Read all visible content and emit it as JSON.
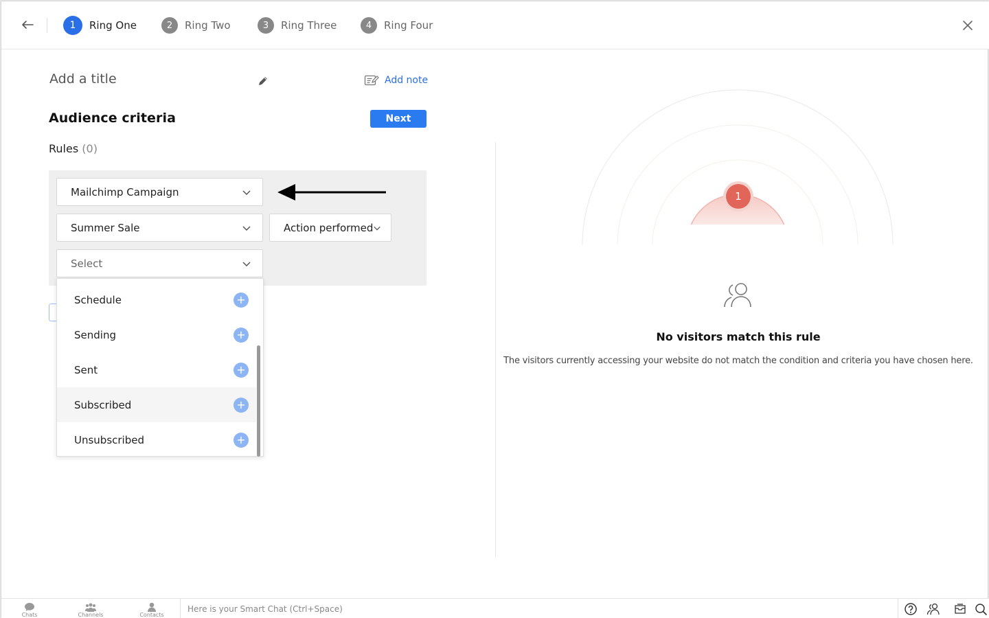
{
  "header": {
    "steps": [
      {
        "num": "1",
        "label": "Ring One"
      },
      {
        "num": "2",
        "label": "Ring Two"
      },
      {
        "num": "3",
        "label": "Ring Three"
      },
      {
        "num": "4",
        "label": "Ring Four"
      }
    ]
  },
  "editor": {
    "title_placeholder": "Add a title",
    "add_note": "Add note",
    "section_title": "Audience criteria",
    "next_label": "Next",
    "rules_label": "Rules",
    "rules_count": "(0)"
  },
  "rule": {
    "source": "Mailchimp Campaign",
    "campaign": "Summer Sale",
    "action": "Action performed",
    "event_placeholder": "Select"
  },
  "dropdown": {
    "options": [
      "Schedule",
      "Sending",
      "Sent",
      "Subscribed",
      "Unsubscribed"
    ],
    "hovered": "Subscribed"
  },
  "preview": {
    "ring_badge": "1",
    "empty_title": "No visitors match this rule",
    "empty_desc": "The visitors currently accessing your website do not match the condition and criteria you have chosen here."
  },
  "bottom_bar": {
    "nav": [
      "Chats",
      "Channels",
      "Contacts"
    ],
    "smart_chat_placeholder": "Here is your Smart Chat (Ctrl+Space)"
  },
  "colors": {
    "primary": "#2a6fe8",
    "ring_badge": "#e2655a",
    "plus": "#8db4f3"
  }
}
